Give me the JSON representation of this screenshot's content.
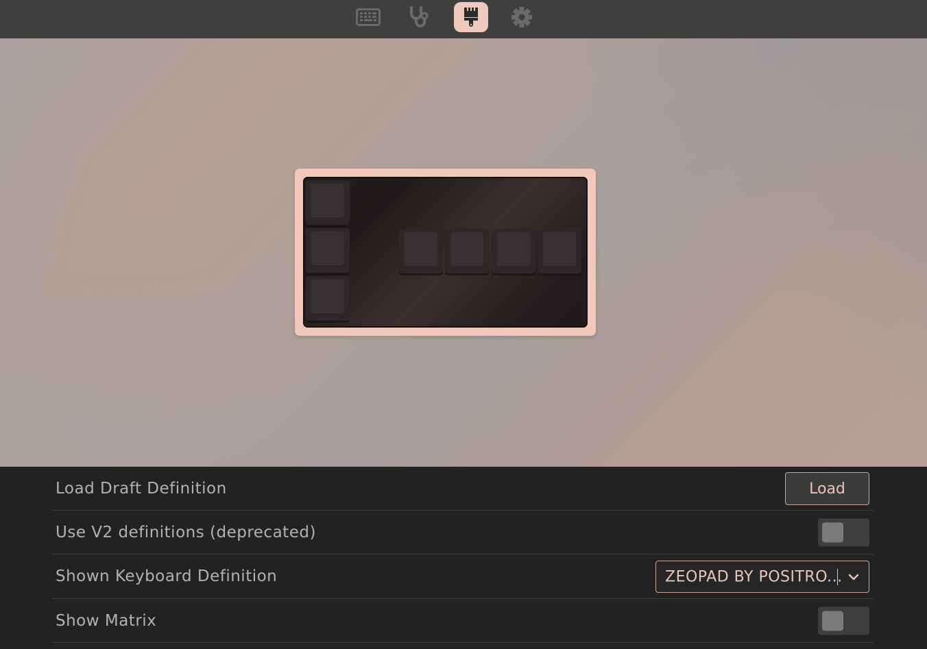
{
  "nav": {
    "items": [
      {
        "icon": "keyboard-icon",
        "active": false
      },
      {
        "icon": "stethoscope-icon",
        "active": false
      },
      {
        "icon": "paintbrush-icon",
        "active": true
      },
      {
        "icon": "gear-icon",
        "active": false
      }
    ],
    "colors": {
      "bar": "#3f3f3f",
      "active_bg": "#f0c9bd",
      "icon": "#6a6a6a",
      "active_icon": "#2a2a2a"
    }
  },
  "keyboard_preview": {
    "frame_color": "#f1c8bb",
    "plate_color": "#231e1d",
    "key_color": "#2b2827"
  },
  "settings": {
    "load_draft": {
      "label": "Load Draft Definition",
      "button": "Load"
    },
    "use_v2": {
      "label": "Use V2 definitions (deprecated)",
      "enabled": false
    },
    "shown_definition": {
      "label": "Shown Keyboard Definition",
      "value": "ZEOPAD BY POSITRO..."
    },
    "show_matrix": {
      "label": "Show Matrix",
      "enabled": false
    }
  },
  "colors": {
    "accent": "#eac6ba",
    "panel_bg": "#222222",
    "label": "#b2b2b2"
  }
}
